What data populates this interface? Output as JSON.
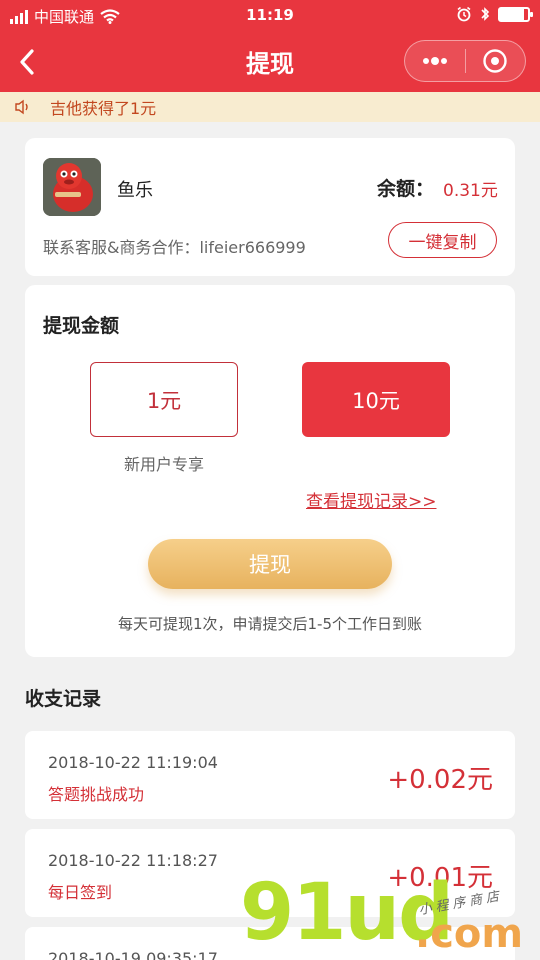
{
  "status_bar": {
    "carrier": "中国联通",
    "time": "11:19"
  },
  "nav": {
    "title": "提现"
  },
  "notice": {
    "text": "吉他获得了1元"
  },
  "account": {
    "name": "鱼乐",
    "balance_label": "余额：",
    "balance_value": "0.31元",
    "contact": "联系客服&商务合作：lifeier666999",
    "copy_label": "一键复制"
  },
  "withdraw": {
    "title": "提现金额",
    "options": [
      {
        "label": "1元",
        "selected": false
      },
      {
        "label": "10元",
        "selected": true
      }
    ],
    "option_note": "新用户专享",
    "record_link": "查看提现记录>>",
    "button_label": "提现",
    "tip": "每天可提现1次，申请提交后1-5个工作日到账"
  },
  "records": {
    "title": "收支记录",
    "items": [
      {
        "time": "2018-10-22 11:19:04",
        "desc": "答题挑战成功",
        "amount": "+0.02元"
      },
      {
        "time": "2018-10-22 11:18:27",
        "desc": "每日签到",
        "amount": "+0.01元"
      },
      {
        "time": "2018-10-19 09:35:17",
        "desc": "",
        "amount": ""
      }
    ]
  },
  "watermark": {
    "big": "91ud",
    "com": ".com",
    "small": "小程序商店"
  },
  "colors": {
    "primary": "#e8363f",
    "accent_text": "#d43037",
    "gold": "#e7b25e",
    "notice_bg": "#f8ecd0"
  }
}
